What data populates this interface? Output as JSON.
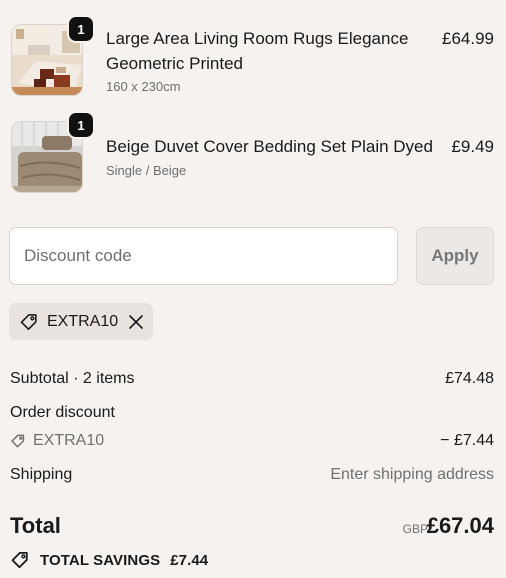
{
  "cart": {
    "items": [
      {
        "name_line1": "Large Area Living Room Rugs Elegance",
        "name_line2": "Geometric Printed",
        "variant": "160 x 230cm",
        "price": "£64.99",
        "quantity": "1",
        "image_icon": "rug-product-image"
      },
      {
        "name_line1": "Beige Duvet Cover Bedding Set Plain Dyed",
        "variant": "Single / Beige",
        "price": "£9.49",
        "quantity": "1",
        "image_icon": "duvet-product-image"
      }
    ]
  },
  "discount": {
    "placeholder": "Discount code",
    "apply_label": "Apply",
    "applied_code": "EXTRA10"
  },
  "summary": {
    "subtotal_label": "Subtotal · 2 items",
    "subtotal_value": "£74.48",
    "order_discount_label": "Order discount",
    "discount_code": "EXTRA10",
    "discount_value": "− £7.44",
    "shipping_label": "Shipping",
    "shipping_value": "Enter shipping address",
    "total_label": "Total",
    "currency": "GBP",
    "total_value": "£67.04",
    "savings_label": "TOTAL SAVINGS",
    "savings_value": "£7.44"
  },
  "colors": {
    "background": "#f5f2ef",
    "badge": "#111111",
    "chip": "#e8e3de",
    "muted_text": "#707070"
  }
}
